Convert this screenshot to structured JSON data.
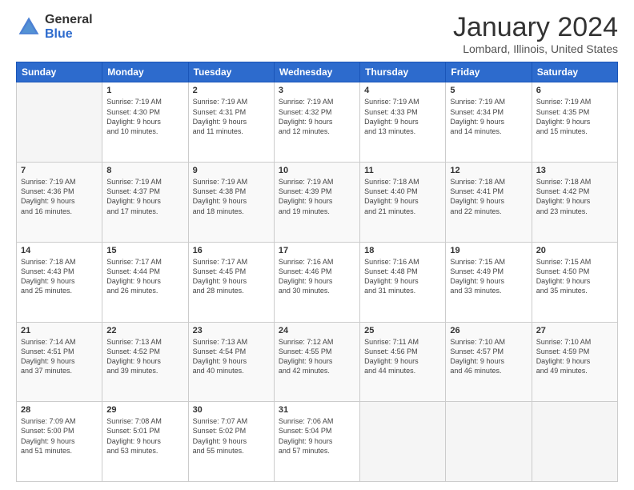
{
  "header": {
    "logo_general": "General",
    "logo_blue": "Blue",
    "title": "January 2024",
    "location": "Lombard, Illinois, United States"
  },
  "weekdays": [
    "Sunday",
    "Monday",
    "Tuesday",
    "Wednesday",
    "Thursday",
    "Friday",
    "Saturday"
  ],
  "weeks": [
    [
      {
        "day": "",
        "info": ""
      },
      {
        "day": "1",
        "info": "Sunrise: 7:19 AM\nSunset: 4:30 PM\nDaylight: 9 hours\nand 10 minutes."
      },
      {
        "day": "2",
        "info": "Sunrise: 7:19 AM\nSunset: 4:31 PM\nDaylight: 9 hours\nand 11 minutes."
      },
      {
        "day": "3",
        "info": "Sunrise: 7:19 AM\nSunset: 4:32 PM\nDaylight: 9 hours\nand 12 minutes."
      },
      {
        "day": "4",
        "info": "Sunrise: 7:19 AM\nSunset: 4:33 PM\nDaylight: 9 hours\nand 13 minutes."
      },
      {
        "day": "5",
        "info": "Sunrise: 7:19 AM\nSunset: 4:34 PM\nDaylight: 9 hours\nand 14 minutes."
      },
      {
        "day": "6",
        "info": "Sunrise: 7:19 AM\nSunset: 4:35 PM\nDaylight: 9 hours\nand 15 minutes."
      }
    ],
    [
      {
        "day": "7",
        "info": "Sunrise: 7:19 AM\nSunset: 4:36 PM\nDaylight: 9 hours\nand 16 minutes."
      },
      {
        "day": "8",
        "info": "Sunrise: 7:19 AM\nSunset: 4:37 PM\nDaylight: 9 hours\nand 17 minutes."
      },
      {
        "day": "9",
        "info": "Sunrise: 7:19 AM\nSunset: 4:38 PM\nDaylight: 9 hours\nand 18 minutes."
      },
      {
        "day": "10",
        "info": "Sunrise: 7:19 AM\nSunset: 4:39 PM\nDaylight: 9 hours\nand 19 minutes."
      },
      {
        "day": "11",
        "info": "Sunrise: 7:18 AM\nSunset: 4:40 PM\nDaylight: 9 hours\nand 21 minutes."
      },
      {
        "day": "12",
        "info": "Sunrise: 7:18 AM\nSunset: 4:41 PM\nDaylight: 9 hours\nand 22 minutes."
      },
      {
        "day": "13",
        "info": "Sunrise: 7:18 AM\nSunset: 4:42 PM\nDaylight: 9 hours\nand 23 minutes."
      }
    ],
    [
      {
        "day": "14",
        "info": "Sunrise: 7:18 AM\nSunset: 4:43 PM\nDaylight: 9 hours\nand 25 minutes."
      },
      {
        "day": "15",
        "info": "Sunrise: 7:17 AM\nSunset: 4:44 PM\nDaylight: 9 hours\nand 26 minutes."
      },
      {
        "day": "16",
        "info": "Sunrise: 7:17 AM\nSunset: 4:45 PM\nDaylight: 9 hours\nand 28 minutes."
      },
      {
        "day": "17",
        "info": "Sunrise: 7:16 AM\nSunset: 4:46 PM\nDaylight: 9 hours\nand 30 minutes."
      },
      {
        "day": "18",
        "info": "Sunrise: 7:16 AM\nSunset: 4:48 PM\nDaylight: 9 hours\nand 31 minutes."
      },
      {
        "day": "19",
        "info": "Sunrise: 7:15 AM\nSunset: 4:49 PM\nDaylight: 9 hours\nand 33 minutes."
      },
      {
        "day": "20",
        "info": "Sunrise: 7:15 AM\nSunset: 4:50 PM\nDaylight: 9 hours\nand 35 minutes."
      }
    ],
    [
      {
        "day": "21",
        "info": "Sunrise: 7:14 AM\nSunset: 4:51 PM\nDaylight: 9 hours\nand 37 minutes."
      },
      {
        "day": "22",
        "info": "Sunrise: 7:13 AM\nSunset: 4:52 PM\nDaylight: 9 hours\nand 39 minutes."
      },
      {
        "day": "23",
        "info": "Sunrise: 7:13 AM\nSunset: 4:54 PM\nDaylight: 9 hours\nand 40 minutes."
      },
      {
        "day": "24",
        "info": "Sunrise: 7:12 AM\nSunset: 4:55 PM\nDaylight: 9 hours\nand 42 minutes."
      },
      {
        "day": "25",
        "info": "Sunrise: 7:11 AM\nSunset: 4:56 PM\nDaylight: 9 hours\nand 44 minutes."
      },
      {
        "day": "26",
        "info": "Sunrise: 7:10 AM\nSunset: 4:57 PM\nDaylight: 9 hours\nand 46 minutes."
      },
      {
        "day": "27",
        "info": "Sunrise: 7:10 AM\nSunset: 4:59 PM\nDaylight: 9 hours\nand 49 minutes."
      }
    ],
    [
      {
        "day": "28",
        "info": "Sunrise: 7:09 AM\nSunset: 5:00 PM\nDaylight: 9 hours\nand 51 minutes."
      },
      {
        "day": "29",
        "info": "Sunrise: 7:08 AM\nSunset: 5:01 PM\nDaylight: 9 hours\nand 53 minutes."
      },
      {
        "day": "30",
        "info": "Sunrise: 7:07 AM\nSunset: 5:02 PM\nDaylight: 9 hours\nand 55 minutes."
      },
      {
        "day": "31",
        "info": "Sunrise: 7:06 AM\nSunset: 5:04 PM\nDaylight: 9 hours\nand 57 minutes."
      },
      {
        "day": "",
        "info": ""
      },
      {
        "day": "",
        "info": ""
      },
      {
        "day": "",
        "info": ""
      }
    ]
  ]
}
